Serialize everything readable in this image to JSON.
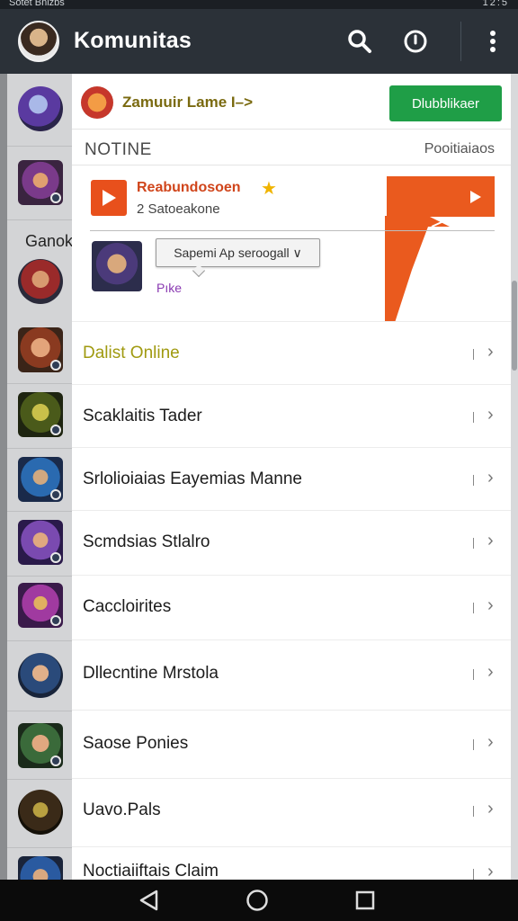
{
  "status_bar": {
    "left_text": "Sotet Bnizbs",
    "right_text": "12:5"
  },
  "app_bar": {
    "title": "Komunitas"
  },
  "rail": {
    "section_label": "Ganok"
  },
  "game_header": {
    "name": "Zamuuir Lame I–>",
    "subscribe_label": "Dlubblikaer"
  },
  "notice": {
    "label": "NOTINE",
    "positions_label": "Pooitiaiaos"
  },
  "stream": {
    "name": "Reabundosoen",
    "subtitle": "2 Satoeakone"
  },
  "comment": {
    "bubble_text": "Sapemi Ap seroogall ∨",
    "reply_text": "Pıke"
  },
  "list": {
    "items": [
      {
        "label": "Dalist Online"
      },
      {
        "label": "Scaklaitis Tader"
      },
      {
        "label": "Srlolioiaias Eayemias Manne"
      },
      {
        "label": "Scmdsias Stlalro"
      },
      {
        "label": "Caccloirites"
      },
      {
        "label": "Dllecntine Mrstola"
      },
      {
        "label": "Saose Ponies"
      },
      {
        "label": "Uavo.Pals"
      },
      {
        "label": "Noctiaiiftais Claim"
      }
    ]
  },
  "colors": {
    "app_bar": "#2b3138",
    "subscribe": "#1f9e47",
    "accent_orange": "#ea5a1e"
  }
}
